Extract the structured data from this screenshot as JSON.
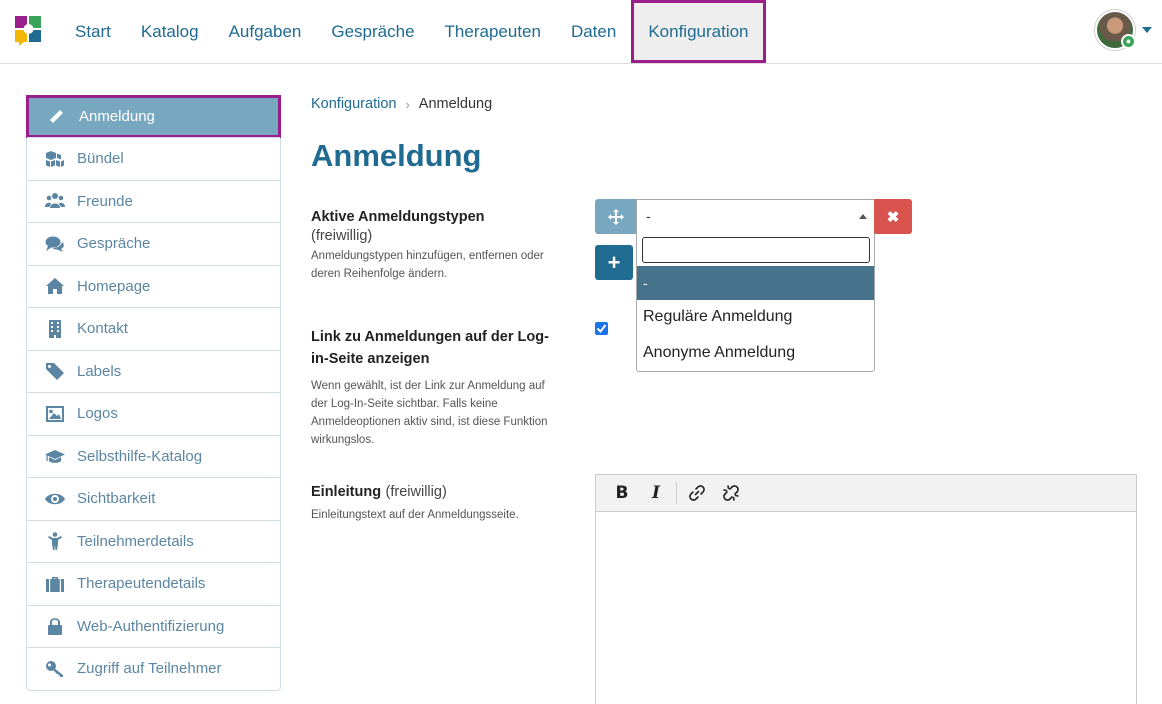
{
  "nav": {
    "items": [
      {
        "label": "Start"
      },
      {
        "label": "Katalog"
      },
      {
        "label": "Aufgaben"
      },
      {
        "label": "Gespräche"
      },
      {
        "label": "Therapeuten"
      },
      {
        "label": "Daten"
      },
      {
        "label": "Konfiguration",
        "active": true
      }
    ]
  },
  "sidebar": {
    "items": [
      {
        "label": "Anmeldung",
        "icon": "pencil-icon",
        "active": true
      },
      {
        "label": "Bündel",
        "icon": "cubes-icon"
      },
      {
        "label": "Freunde",
        "icon": "users-icon"
      },
      {
        "label": "Gespräche",
        "icon": "comments-icon"
      },
      {
        "label": "Homepage",
        "icon": "home-icon"
      },
      {
        "label": "Kontakt",
        "icon": "building-icon"
      },
      {
        "label": "Labels",
        "icon": "tag-icon"
      },
      {
        "label": "Logos",
        "icon": "image-icon"
      },
      {
        "label": "Selbsthilfe-Katalog",
        "icon": "graduation-cap-icon"
      },
      {
        "label": "Sichtbarkeit",
        "icon": "eye-icon"
      },
      {
        "label": "Teilnehmerdetails",
        "icon": "child-icon"
      },
      {
        "label": "Therapeutendetails",
        "icon": "briefcase-icon"
      },
      {
        "label": "Web-Authentifizierung",
        "icon": "lock-icon"
      },
      {
        "label": "Zugriff auf Teilnehmer",
        "icon": "key-icon"
      }
    ]
  },
  "breadcrumb": {
    "parent": "Konfiguration",
    "separator": "›",
    "current": "Anmeldung"
  },
  "page": {
    "title": "Anmeldung"
  },
  "fields": {
    "types": {
      "label": "Aktive Anmeldungstypen",
      "optional": "(freiwillig)",
      "help": "Anmeldungstypen hinzufügen, entfernen oder deren Reihenfolge ändern.",
      "selected_value": "-",
      "search_value": "",
      "options": [
        "-",
        "Reguläre Anmeldung",
        "Anonyme Anmeldung"
      ],
      "highlighted_option": "-",
      "remove_label": "✖",
      "add_label": "+"
    },
    "link": {
      "label": "Link zu Anmeldungen auf der Log-in-Seite anzeigen",
      "help": "Wenn gewählt, ist der Link zur Anmeldung auf der Log-In-Seite sichtbar. Falls keine Anmeldeoptionen aktiv sind, ist diese Funktion wirkungslos.",
      "checked": true
    },
    "intro": {
      "label": "Einleitung",
      "optional": "(freiwillig)",
      "help": "Einleitungstext auf der Anmeldungsseite.",
      "toolbar": {
        "bold": "B",
        "italic": "I"
      }
    }
  },
  "colors": {
    "brand": "#1f6b91",
    "highlight_frame": "#9b1f8a",
    "sidebar_active": "#78a8c0",
    "danger": "#d9534f",
    "option_highlight": "#46738b"
  }
}
